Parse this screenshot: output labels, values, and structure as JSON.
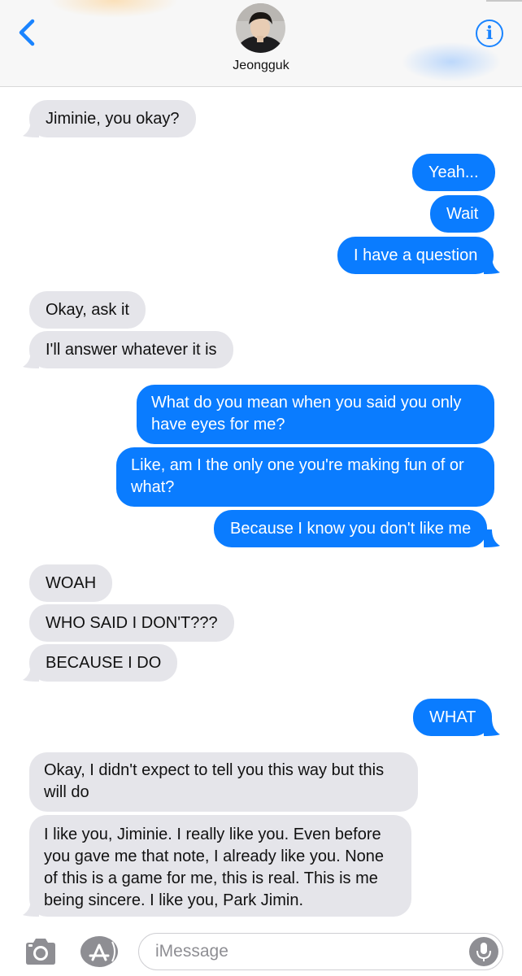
{
  "header": {
    "contact_name": "Jeongguk",
    "info_glyph": "i",
    "back_icon": "chevron-left-icon",
    "accent_color": "#1a84ff"
  },
  "messages": [
    {
      "side": "in",
      "text": "Jiminie, you okay?"
    },
    {
      "side": "out",
      "text": "Yeah..."
    },
    {
      "side": "out",
      "text": "Wait"
    },
    {
      "side": "out",
      "text": "I have a question"
    },
    {
      "side": "in",
      "text": "Okay, ask it"
    },
    {
      "side": "in",
      "text": "I'll answer whatever it is"
    },
    {
      "side": "out",
      "text": "What do you mean when you said you only have eyes for me?"
    },
    {
      "side": "out",
      "text": "Like, am I the only one you're making fun of or what?"
    },
    {
      "side": "out",
      "text": "Because I know you don't like me"
    },
    {
      "side": "in",
      "text": "WOAH"
    },
    {
      "side": "in",
      "text": "WHO SAID I DON'T???"
    },
    {
      "side": "in",
      "text": "BECAUSE I DO"
    },
    {
      "side": "out",
      "text": "WHAT"
    },
    {
      "side": "in",
      "text": "Okay, I didn't expect to tell you this way but this will do"
    },
    {
      "side": "in",
      "text": "I like you, Jiminie. I really like you. Even before you gave me that note, I already like you. None of this is a game for me, this is real. This is me being sincere. I like you, Park Jimin."
    }
  ],
  "colors": {
    "incoming_bubble": "#e5e5ea",
    "outgoing_bubble": "#0a7cff"
  },
  "input_bar": {
    "placeholder": "iMessage",
    "camera_icon": "camera-icon",
    "apps_icon": "app-store-icon",
    "mic_icon": "microphone-icon"
  }
}
